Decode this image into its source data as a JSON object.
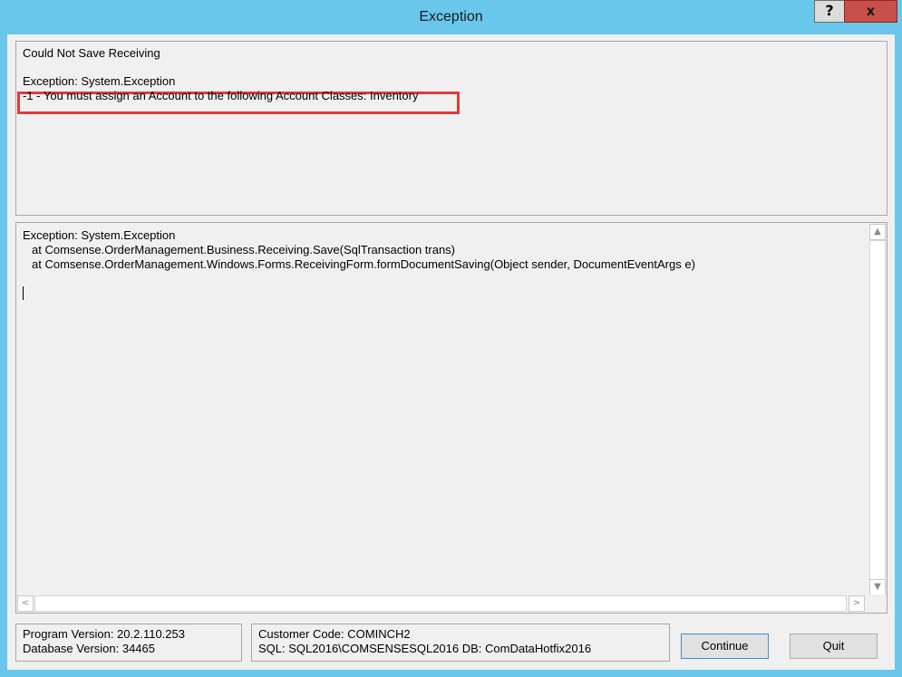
{
  "window": {
    "title": "Exception",
    "help_label": "?",
    "close_label": "x"
  },
  "message": {
    "line1": "Could Not Save Receiving",
    "line2": "Exception: System.Exception",
    "line3": "-1 - You must assign an Account to the following Account Classes: Inventory"
  },
  "trace": {
    "lines": [
      "Exception: System.Exception",
      "at Comsense.OrderManagement.Business.Receiving.Save(SqlTransaction trans)",
      "at Comsense.OrderManagement.Windows.Forms.ReceivingForm.formDocumentSaving(Object sender, DocumentEventArgs e)"
    ]
  },
  "scrollbar": {
    "up_icon": "▲",
    "down_icon": "▼",
    "left_icon": "<",
    "right_icon": ">"
  },
  "version_info": {
    "program": "Program Version: 20.2.110.253",
    "database": "Database Version: 34465"
  },
  "customer_info": {
    "code": "Customer Code: COMINCH2",
    "sql": "SQL: SQL2016\\COMSENSESQL2016 DB: ComDataHotfix2016"
  },
  "buttons": {
    "continue_label": "Continue",
    "quit_label": "Quit"
  },
  "colors": {
    "titlebar": "#69c7ec",
    "close_button": "#c7504b",
    "highlight_border": "#e23b3b",
    "dialog_background": "#f0f0f0"
  }
}
